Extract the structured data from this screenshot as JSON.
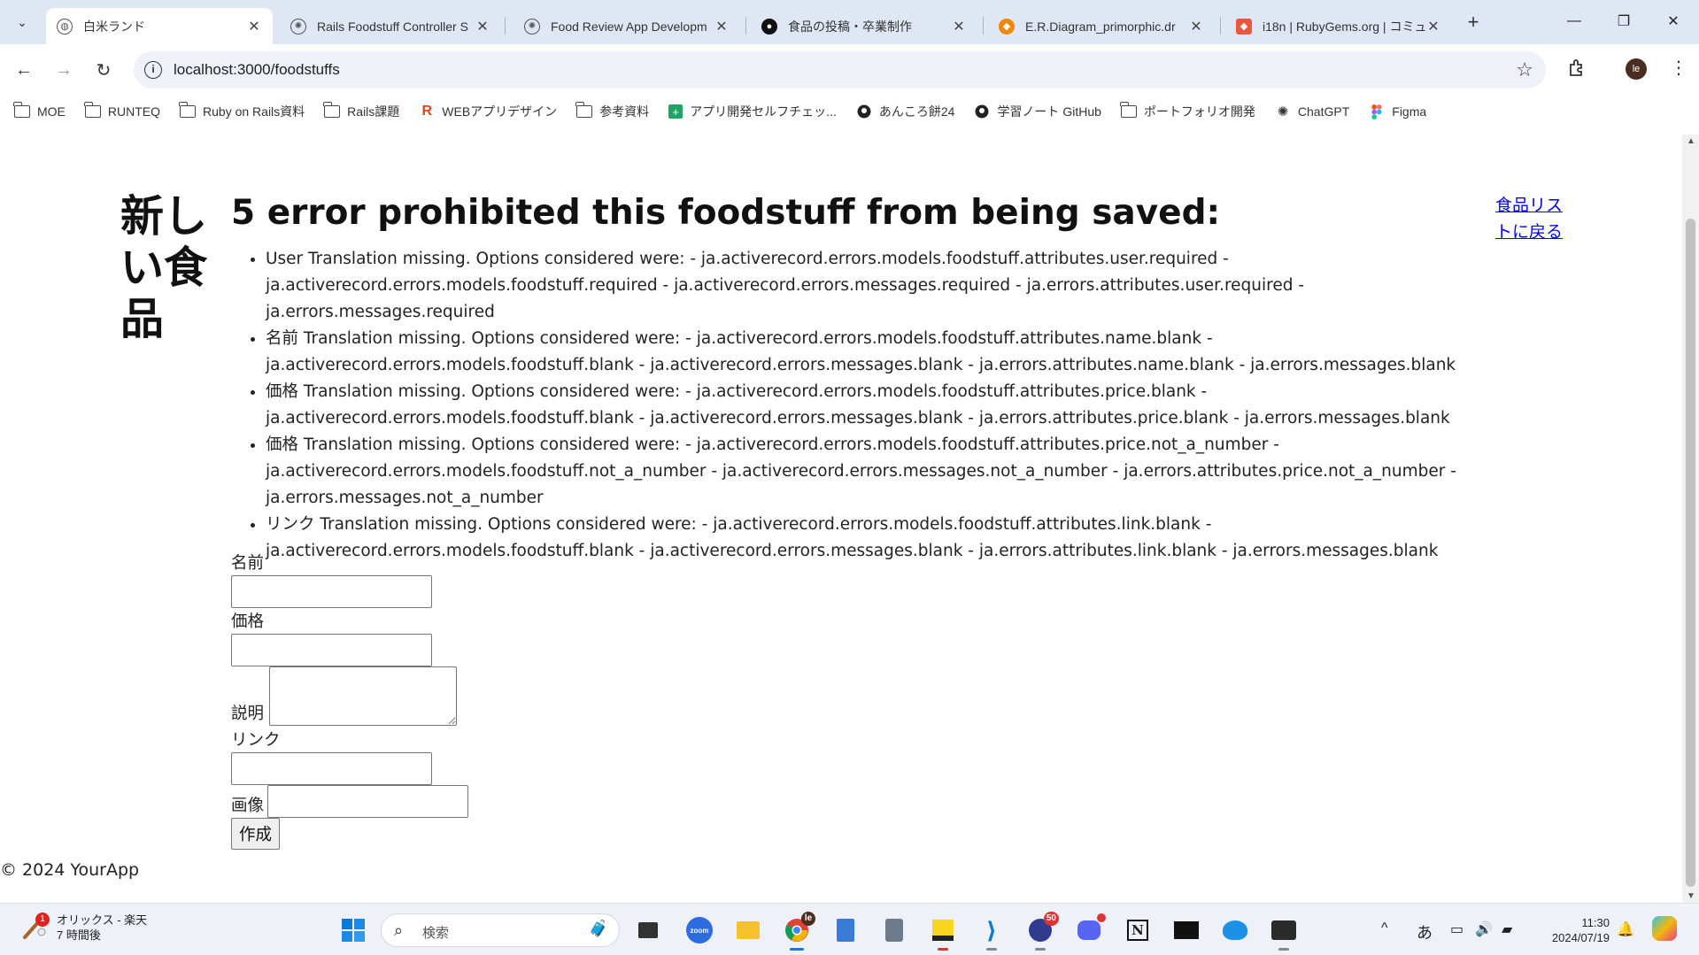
{
  "browser": {
    "tabs": [
      {
        "title": "白米ランド",
        "active": true,
        "favicon": "globe-icon"
      },
      {
        "title": "Rails Foodstuff Controller S",
        "active": false,
        "favicon": "openai-icon"
      },
      {
        "title": "Food Review App Developm",
        "active": false,
        "favicon": "openai-icon"
      },
      {
        "title": "食品の投稿・卒業制作",
        "active": false,
        "favicon": "github-icon"
      },
      {
        "title": "E.R.Diagram_primorphic.dr",
        "active": false,
        "favicon": "drawio-icon"
      },
      {
        "title": "i18n | RubyGems.org | コミュ",
        "active": false,
        "favicon": "rubygems-icon"
      }
    ],
    "url": "localhost:3000/foodstuffs",
    "profile_initials": "le",
    "bookmarks": [
      {
        "label": "MOE",
        "icon": "folder-icon"
      },
      {
        "label": "RUNTEQ",
        "icon": "folder-icon"
      },
      {
        "label": "Ruby on Rails資料",
        "icon": "folder-icon"
      },
      {
        "label": "Rails課題",
        "icon": "folder-icon"
      },
      {
        "label": "WEBアプリデザイン",
        "icon": "r-logo-icon"
      },
      {
        "label": "参考資料",
        "icon": "folder-icon"
      },
      {
        "label": "アプリ開発セルフチェッ...",
        "icon": "sheets-icon"
      },
      {
        "label": "あんころ餅24",
        "icon": "github-icon"
      },
      {
        "label": "学習ノート GitHub",
        "icon": "github-icon"
      },
      {
        "label": "ポートフォリオ開発",
        "icon": "folder-icon"
      },
      {
        "label": "ChatGPT",
        "icon": "openai-icon"
      },
      {
        "label": "Figma",
        "icon": "figma-icon"
      }
    ]
  },
  "page": {
    "heading": "新しい食品",
    "error_title": "5 error prohibited this foodstuff from being saved:",
    "errors": [
      "User Translation missing. Options considered were: - ja.activerecord.errors.models.foodstuff.attributes.user.required - ja.activerecord.errors.models.foodstuff.required - ja.activerecord.errors.messages.required - ja.errors.attributes.user.required - ja.errors.messages.required",
      "名前 Translation missing. Options considered were: - ja.activerecord.errors.models.foodstuff.attributes.name.blank - ja.activerecord.errors.models.foodstuff.blank - ja.activerecord.errors.messages.blank - ja.errors.attributes.name.blank - ja.errors.messages.blank",
      "価格 Translation missing. Options considered were: - ja.activerecord.errors.models.foodstuff.attributes.price.blank - ja.activerecord.errors.models.foodstuff.blank - ja.activerecord.errors.messages.blank - ja.errors.attributes.price.blank - ja.errors.messages.blank",
      "価格 Translation missing. Options considered were: - ja.activerecord.errors.models.foodstuff.attributes.price.not_a_number - ja.activerecord.errors.models.foodstuff.not_a_number - ja.activerecord.errors.messages.not_a_number - ja.errors.attributes.price.not_a_number - ja.errors.messages.not_a_number",
      "リンク Translation missing. Options considered were: - ja.activerecord.errors.models.foodstuff.attributes.link.blank - ja.activerecord.errors.models.foodstuff.blank - ja.activerecord.errors.messages.blank - ja.errors.attributes.link.blank - ja.errors.messages.blank"
    ],
    "back_link": "食品リストに戻る",
    "form": {
      "name_label": "名前",
      "name_value": "",
      "price_label": "価格",
      "price_value": "",
      "description_label": "説明",
      "description_value": "",
      "link_label": "リンク",
      "link_value": "",
      "image_label": "画像",
      "image_value": "",
      "submit_label": "作成"
    },
    "footer": "© 2024 YourApp"
  },
  "taskbar": {
    "weather_title": "オリックス - 楽天",
    "weather_sub": "7 時間後",
    "weather_badge": "1",
    "search_placeholder": "検索",
    "chrome_badge": "le",
    "notif_badge": "50",
    "ime": "あ",
    "time": "11:30",
    "date": "2024/07/19"
  }
}
